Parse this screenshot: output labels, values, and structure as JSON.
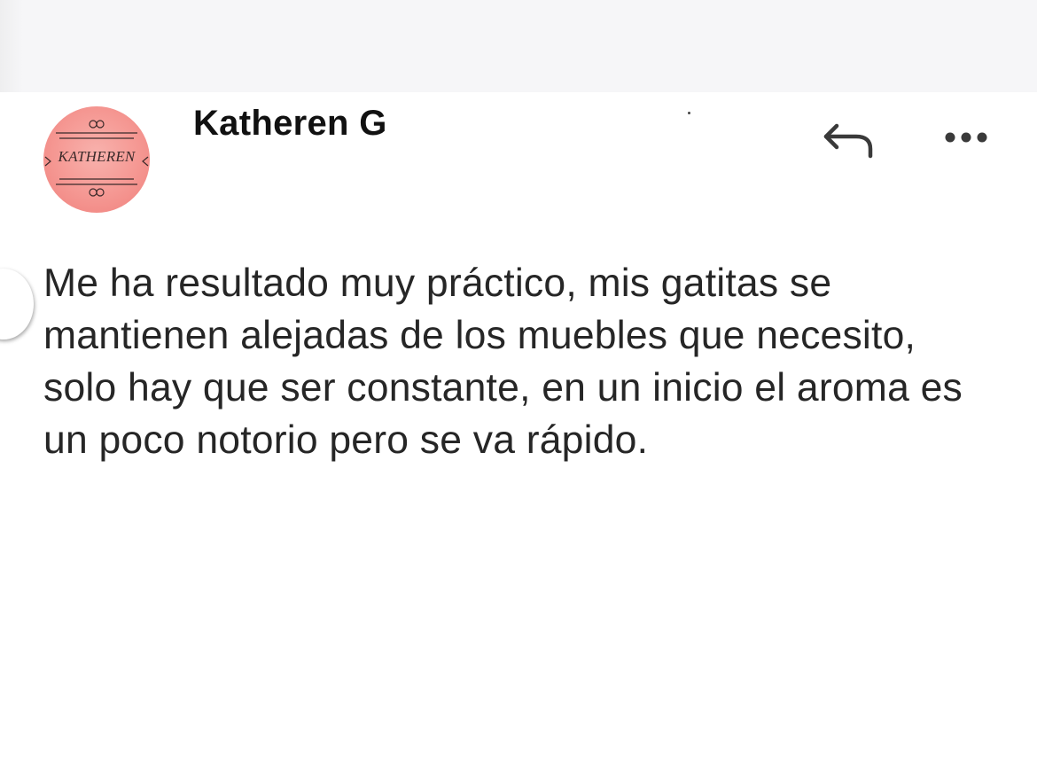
{
  "review": {
    "author_name": "Katheren G",
    "avatar_text": "KATHEREN",
    "message": "Me ha resultado muy práctico, mis gatitas se mantienen alejadas de los muebles que necesito, solo hay que ser constante, en un inicio el aroma es un poco notorio pero se va rápido."
  },
  "icons": {
    "reply": "reply-arrow-icon",
    "more": "more-horizontal-dots-icon"
  },
  "colors": {
    "background": "#f6f6f8",
    "card": "#ffffff",
    "avatar": "#f59792",
    "name_text": "#111111",
    "body_text": "#262626",
    "icon": "#3a3a3a"
  }
}
